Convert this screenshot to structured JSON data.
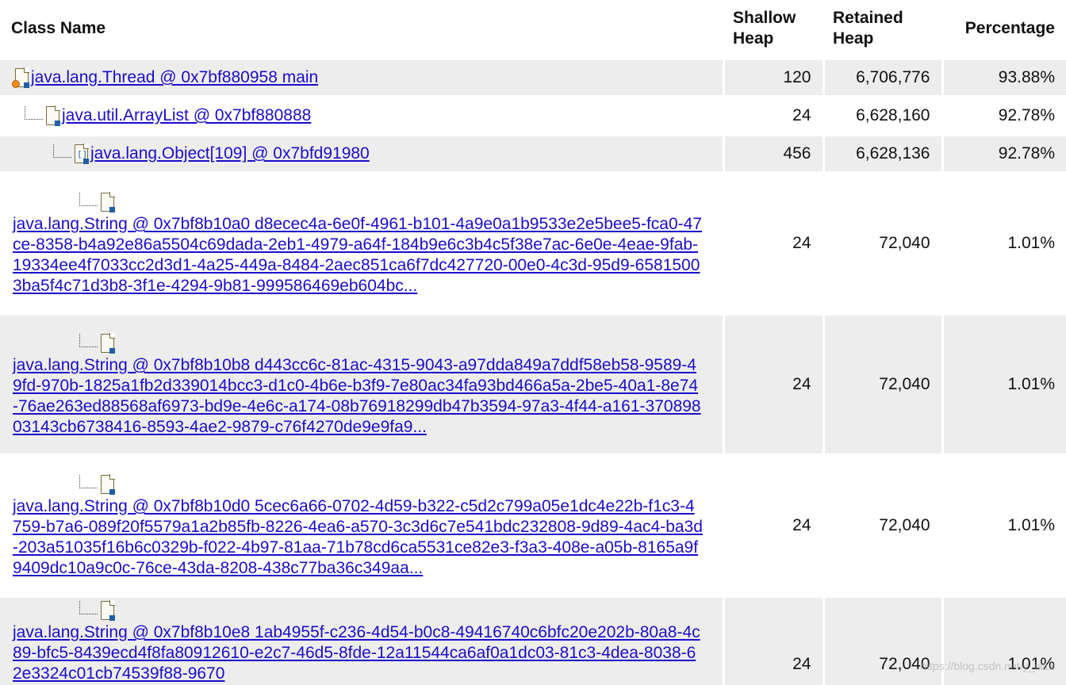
{
  "columns": {
    "name": "Class Name",
    "shallow": "Shallow Heap",
    "retained": "Retained Heap",
    "percentage": "Percentage"
  },
  "rows": [
    {
      "label": "java.lang.Thread @ 0x7bf880958 main",
      "shallow": "120",
      "retained": "6,706,776",
      "percentage": "93.88%",
      "icon": "thread-object-icon"
    },
    {
      "label": "java.util.ArrayList @ 0x7bf880888",
      "shallow": "24",
      "retained": "6,628,160",
      "percentage": "92.78%",
      "icon": "object-icon"
    },
    {
      "label": "java.lang.Object[109] @ 0x7bfd91980",
      "shallow": "456",
      "retained": "6,628,136",
      "percentage": "92.78%",
      "icon": "array-object-icon"
    },
    {
      "label": "java.lang.String @ 0x7bf8b10a0 d8ecec4a-6e0f-4961-b101-4a9e0a1b9533e2e5bee5-fca0-47ce-8358-b4a92e86a5504c69dada-2eb1-4979-a64f-184b9e6c3b4c5f38e7ac-6e0e-4eae-9fab-19334ee4f7033cc2d3d1-4a25-449a-8484-2aec851ca6f7dc427720-00e0-4c3d-95d9-65815003ba5f4c71d3b8-3f1e-4294-9b81-999586469eb604bc...",
      "shallow": "24",
      "retained": "72,040",
      "percentage": "1.01%",
      "icon": "object-icon"
    },
    {
      "label": "java.lang.String @ 0x7bf8b10b8 d443cc6c-81ac-4315-9043-a97dda849a7ddf58eb58-9589-49fd-970b-1825a1fb2d339014bcc3-d1c0-4b6e-b3f9-7e80ac34fa93bd466a5a-2be5-40a1-8e74-76ae263ed88568af6973-bd9e-4e6c-a174-08b76918299db47b3594-97a3-4f44-a161-37089803143cb6738416-8593-4ae2-9879-c76f4270de9e9fa9...",
      "shallow": "24",
      "retained": "72,040",
      "percentage": "1.01%",
      "icon": "object-icon"
    },
    {
      "label": "java.lang.String @ 0x7bf8b10d0 5cec6a66-0702-4d59-b322-c5d2c799a05e1dc4e22b-f1c3-4759-b7a6-089f20f5579a1a2b85fb-8226-4ea6-a570-3c3d6c7e541bdc232808-9d89-4ac4-ba3d-203a51035f16b6c0329b-f022-4b97-81aa-71b78cd6ca5531ce82e3-f3a3-408e-a05b-8165a9f9409dc10a9c0c-76ce-43da-8208-438c77ba36c349aa...",
      "shallow": "24",
      "retained": "72,040",
      "percentage": "1.01%",
      "icon": "object-icon"
    },
    {
      "label": "java.lang.String @ 0x7bf8b10e8 1ab4955f-c236-4d54-b0c8-49416740c6bfc20e202b-80a8-4c89-bfc5-8439ecd4f8fa80912610-e2c7-46d5-8fde-12a11544ca6af0a1dc03-81c3-4dea-8038-62e3324c01cb74539f88-9670",
      "shallow": "24",
      "retained": "72,040",
      "percentage": "1.01%",
      "icon": "object-icon"
    }
  ],
  "watermark": "https://blog.csdn.net/y_ia1s"
}
